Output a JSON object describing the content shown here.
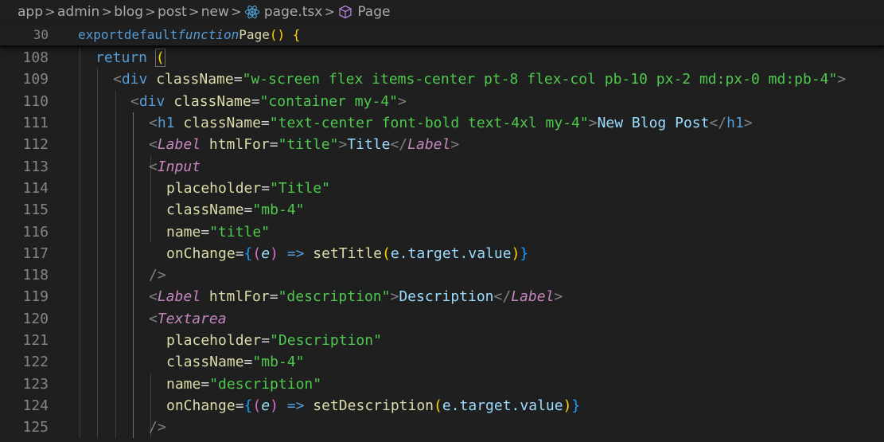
{
  "breadcrumb": {
    "items": [
      "app",
      "admin",
      "blog",
      "post",
      "new",
      "page.tsx",
      "Page"
    ],
    "separator": ">"
  },
  "sticky": {
    "line_number": "30",
    "code": {
      "kw1": "export",
      "kw2": "default",
      "kw3": "function",
      "name": "Page",
      "rest": "() {"
    }
  },
  "lines": [
    {
      "n": "108"
    },
    {
      "n": "109"
    },
    {
      "n": "110"
    },
    {
      "n": "111"
    },
    {
      "n": "112"
    },
    {
      "n": "113"
    },
    {
      "n": "114"
    },
    {
      "n": "115"
    },
    {
      "n": "116"
    },
    {
      "n": "117"
    },
    {
      "n": "118"
    },
    {
      "n": "119"
    },
    {
      "n": "120"
    },
    {
      "n": "121"
    },
    {
      "n": "122"
    },
    {
      "n": "123"
    },
    {
      "n": "124"
    },
    {
      "n": "125"
    }
  ],
  "code": {
    "return": "return",
    "div": "div",
    "className": "className",
    "div1_class": "\"w-screen flex items-center pt-8 flex-col pb-10 px-2 md:px-0 md:pb-4\"",
    "div2_class": "\"container my-4\"",
    "h1": "h1",
    "h1_class": "\"text-center font-bold text-4xl my-4\"",
    "h1_text": "New Blog Post",
    "Label": "Label",
    "htmlFor": "htmlFor",
    "title_str": "\"title\"",
    "title_text": "Title",
    "Input": "Input",
    "placeholder": "placeholder",
    "ph_title": "\"Title\"",
    "mb4": "\"mb-4\"",
    "name": "name",
    "onChange": "onChange",
    "e": "e",
    "setTitle": "setTitle",
    "target_value": "e.target.value",
    "desc_str": "\"description\"",
    "desc_text": "Description",
    "Textarea": "Textarea",
    "ph_desc": "\"Description\"",
    "setDescription": "setDescription"
  },
  "colors": {
    "background": "#1f1f1f",
    "keyword": "#569cd6",
    "string": "#4ec94e",
    "attribute": "#9cdcfe",
    "component": "#c586c0",
    "function": "#dcdcaa"
  },
  "icons": {
    "file": "react-icon",
    "symbol": "cube-icon"
  }
}
